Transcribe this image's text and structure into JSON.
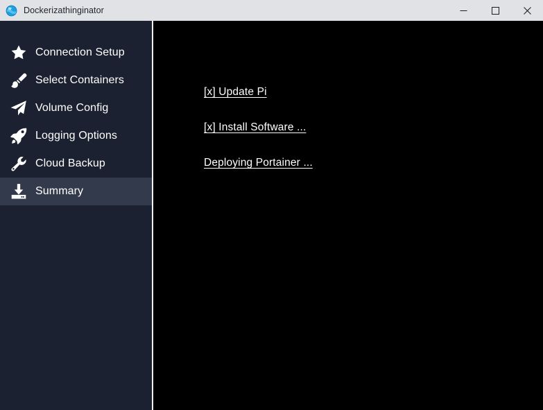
{
  "window": {
    "title": "Dockerizathinginator",
    "app_icon": "docker-whale-icon",
    "controls": {
      "minimize": "minimize-button",
      "maximize": "maximize-button",
      "close": "close-button"
    }
  },
  "colors": {
    "titlebar_bg": "#e1e2e6",
    "titlebar_text": "#20242b",
    "sidebar_bg": "#1b2130",
    "sidebar_active_bg": "#323a4c",
    "sidebar_text": "#ffffff",
    "divider": "#f2f2f4",
    "content_bg": "#000000",
    "content_text": "#ffffff",
    "app_icon_accent": "#1d9fe0"
  },
  "sidebar": {
    "items": [
      {
        "label": "Connection Setup",
        "icon": "star-icon",
        "active": false
      },
      {
        "label": "Select Containers",
        "icon": "paintbrush-icon",
        "active": false
      },
      {
        "label": "Volume Config",
        "icon": "paper-plane-icon",
        "active": false
      },
      {
        "label": "Logging Options",
        "icon": "rocket-icon",
        "active": false
      },
      {
        "label": "Cloud Backup",
        "icon": "wrench-icon",
        "active": false
      },
      {
        "label": "Summary",
        "icon": "download-tray-icon",
        "active": true
      }
    ]
  },
  "content": {
    "tasks": [
      {
        "text": "[x] Update Pi"
      },
      {
        "text": "[x] Install Software ..."
      },
      {
        "text": "Deploying Portainer ..."
      }
    ]
  }
}
